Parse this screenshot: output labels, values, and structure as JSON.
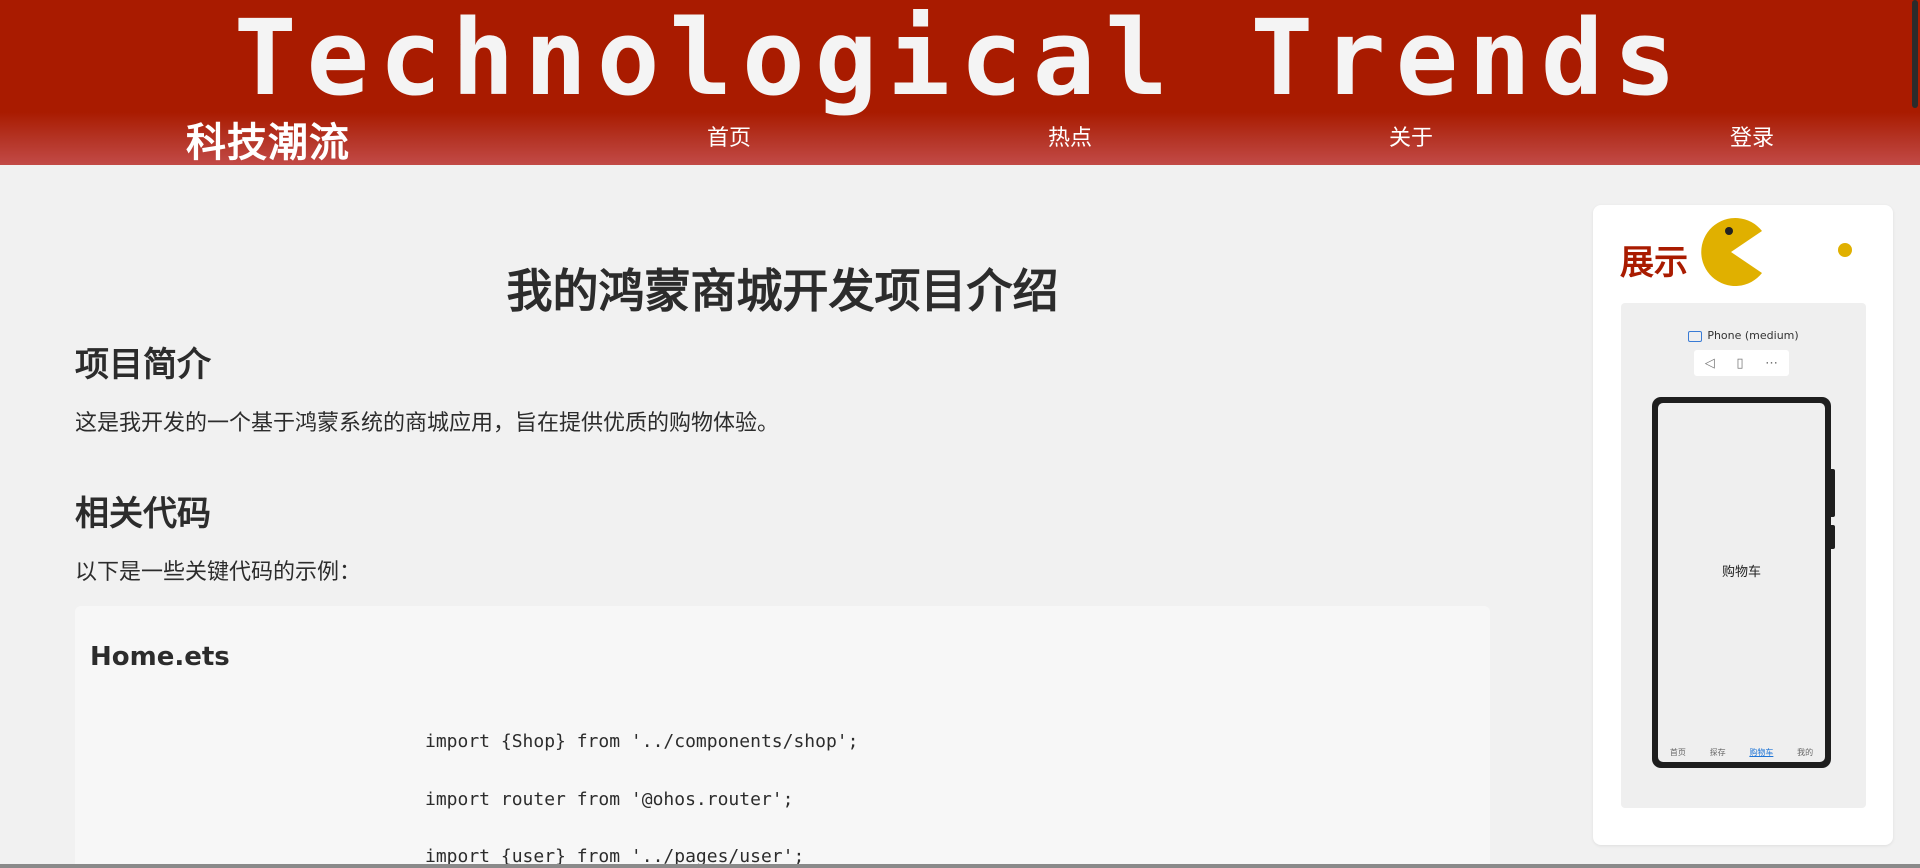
{
  "header": {
    "brand_title": "Technological Trends",
    "brand_cn": "科技潮流",
    "nav": [
      "首页",
      "热点",
      "关于",
      "登录"
    ],
    "bg_color": "#a91b00"
  },
  "main": {
    "page_title": "我的鸿蒙商城开发项目介绍",
    "sections": [
      {
        "heading": "项目简介",
        "text": "这是我开发的一个基于鸿蒙系统的商城应用，旨在提供优质的购物体验。"
      },
      {
        "heading": "相关代码",
        "text": "以下是一些关键代码的示例："
      }
    ],
    "code": {
      "file": "Home.ets",
      "lines": [
        "import {Shop} from '../components/shop';",
        "import router from '@ohos.router';",
        "import {user} from '../pages/user';"
      ]
    }
  },
  "sidebar": {
    "title": "展示",
    "accent_color": "#a91b00",
    "decor_icon": "pacman-icon",
    "preview": {
      "device_label": "Phone (medium)",
      "toolbar_icons": [
        "back-icon",
        "rotate-icon",
        "more-icon"
      ],
      "screen_label": "购物车",
      "tabs": [
        "首页",
        "探存",
        "购物车",
        "我的"
      ],
      "active_tab": "购物车",
      "active_color": "#1e74d6"
    }
  }
}
